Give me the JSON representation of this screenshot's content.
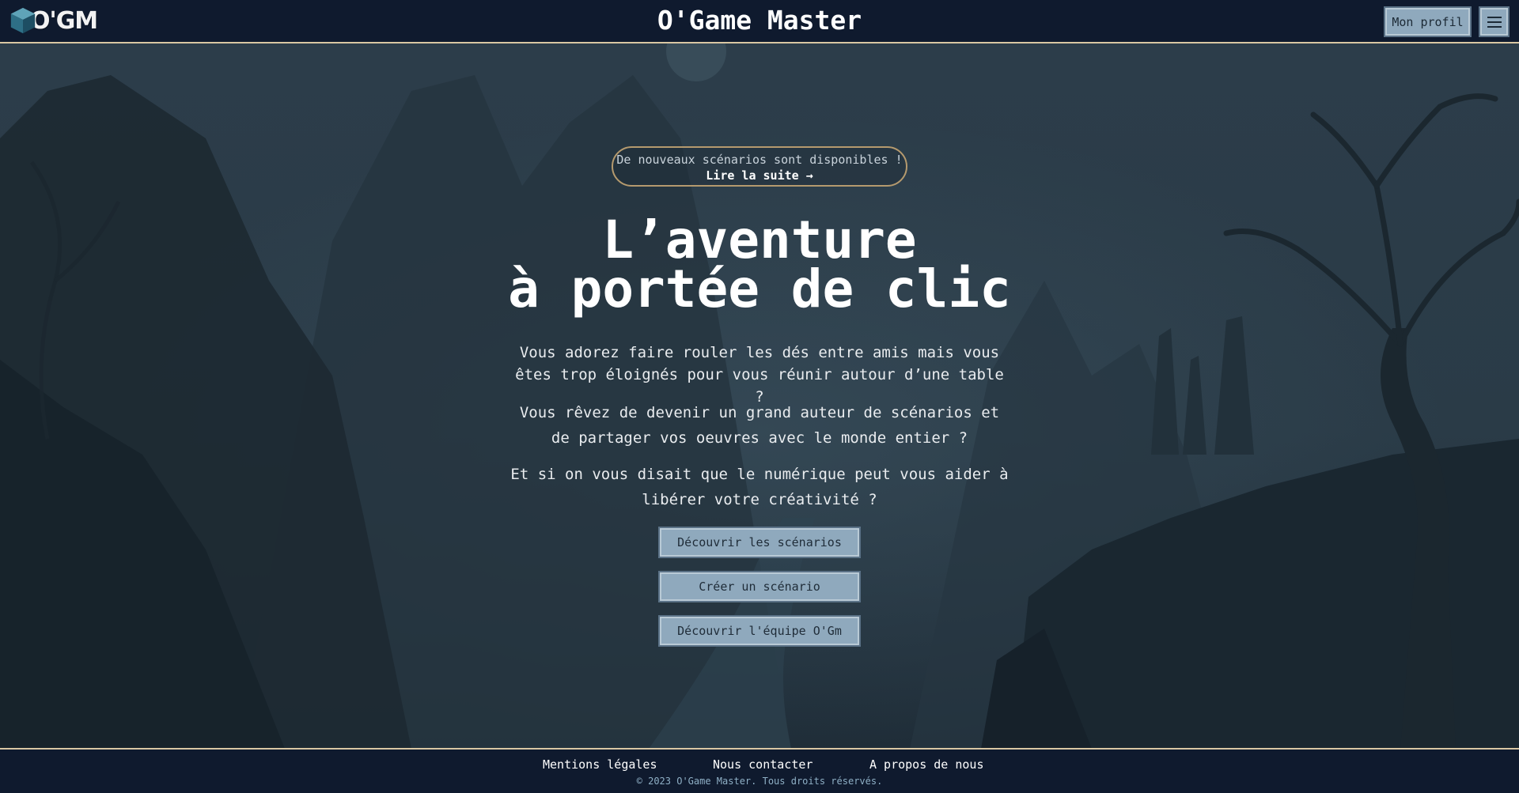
{
  "header": {
    "logo_text": "O'GM",
    "title": "O'Game Master",
    "profile_label": "Mon profil",
    "menu_icon": "hamburger-menu-icon"
  },
  "hero": {
    "banner_text": "De nouveaux scénarios sont disponibles !",
    "banner_link": "Lire la suite →",
    "title_line1": "L’aventure",
    "title_line2": "à portée de clic",
    "paragraph1": "Vous adorez faire rouler les dés entre amis mais vous êtes trop éloignés pour vous réunir autour d’une table ?",
    "paragraph2": "Vous rêvez de devenir un grand auteur de scénarios et de partager vos oeuvres avec le monde entier ?",
    "paragraph3": "Et si on vous disait que le numérique peut vous aider à libérer votre créativité ?",
    "buttons": [
      "Découvrir les scénarios",
      "Créer un scénario",
      "Découvrir l'équipe O'Gm"
    ]
  },
  "footer": {
    "links": [
      "Mentions légales",
      "Nous contacter",
      "A propos de nous"
    ],
    "copyright": "© 2023 O'Game Master. Tous droits réservés."
  },
  "colors": {
    "header_bg": "#0f1a2e",
    "accent_border": "#d9c7a3",
    "button_bg": "#8fa9bd",
    "button_text": "#1f2c38",
    "hero_bg": "#2b3c4a"
  }
}
